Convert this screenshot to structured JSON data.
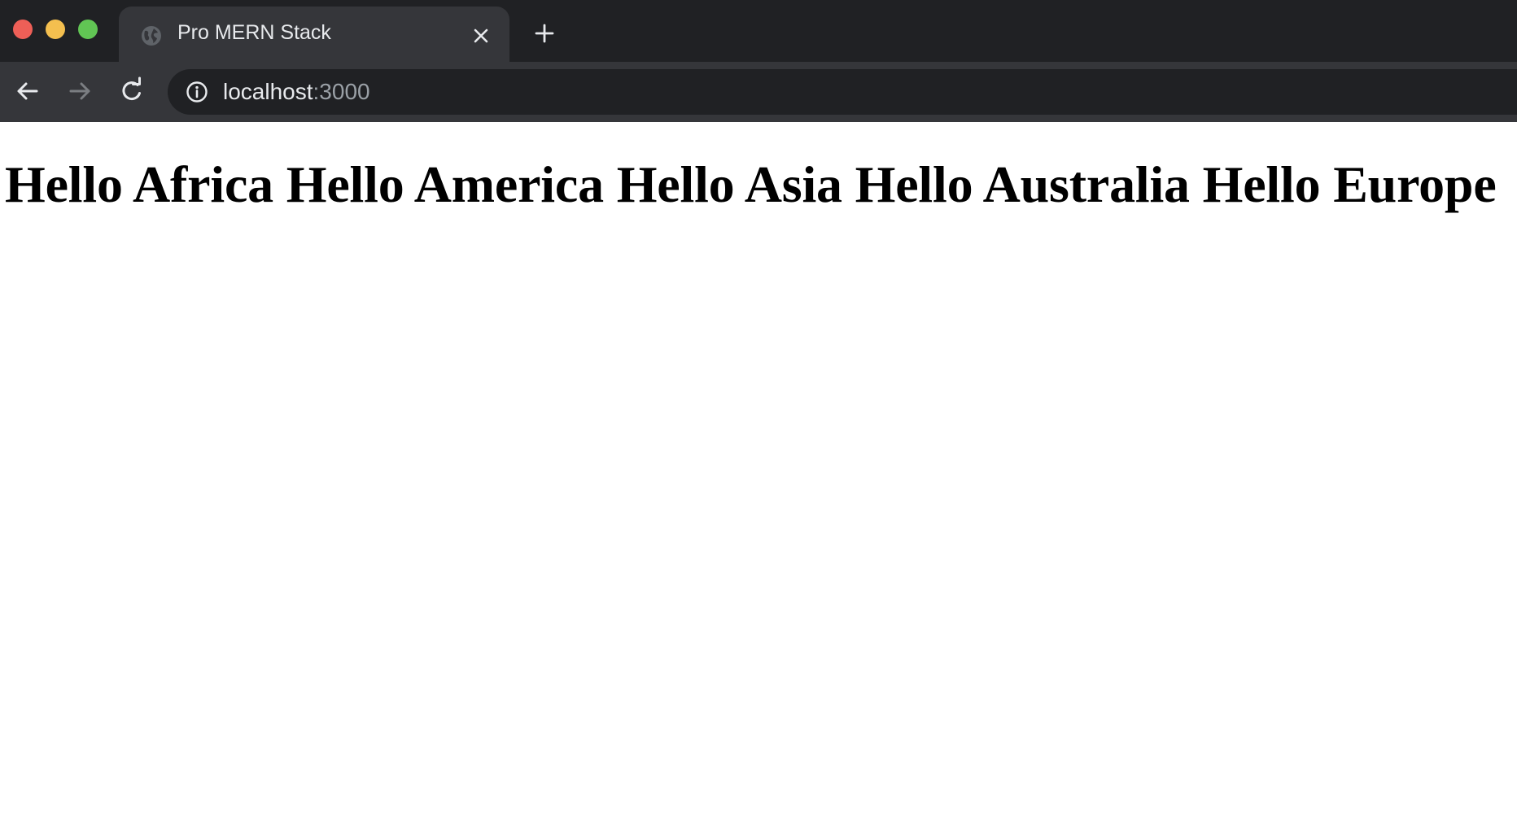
{
  "window": {
    "controls": [
      "close",
      "minimize",
      "maximize"
    ],
    "colors": {
      "close": "#ee5f57",
      "minimize": "#f4bf4f",
      "maximize": "#61c554"
    }
  },
  "tab": {
    "title": "Pro MERN Stack",
    "favicon": "globe-icon",
    "close_icon": "close-icon"
  },
  "new_tab_icon": "plus-icon",
  "toolbar": {
    "back_icon": "arrow-left-icon",
    "forward_icon": "arrow-right-icon",
    "reload_icon": "reload-icon"
  },
  "address_bar": {
    "info_icon": "info-icon",
    "host": "localhost",
    "port": ":3000"
  },
  "page": {
    "heading": "Hello Africa Hello America Hello Asia Hello Australia Hello Europe"
  },
  "theme": {
    "chrome_dark": "#202124",
    "chrome_light": "#35363a",
    "text": "#e8eaed",
    "muted_text": "#9aa0a6"
  }
}
